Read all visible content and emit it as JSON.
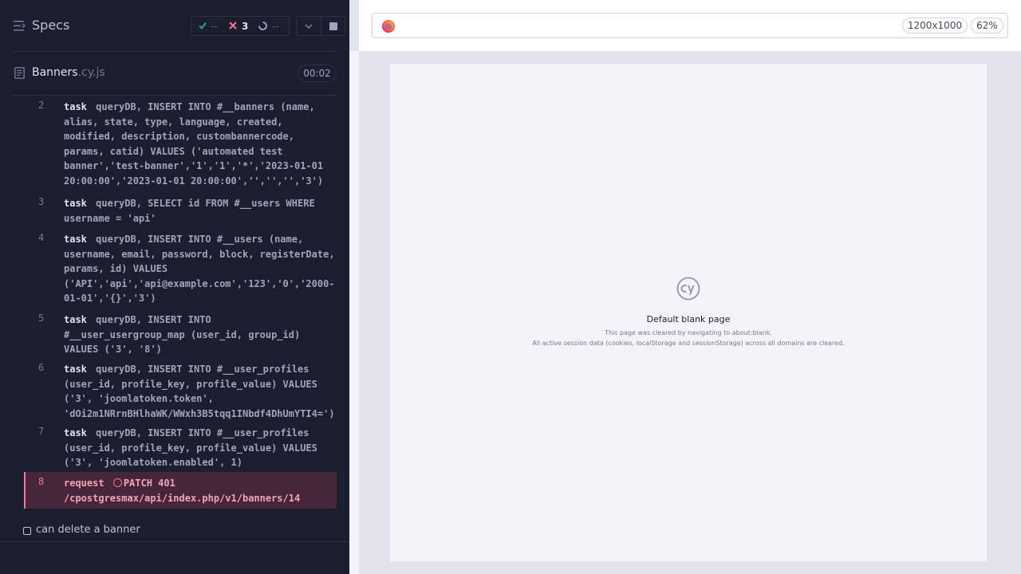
{
  "reporter": {
    "title": "Specs",
    "stats": {
      "passed": "--",
      "failed": "3",
      "pending": "--"
    },
    "file": {
      "name": "Banners",
      "ext": ".cy.js",
      "duration": "00:02"
    },
    "commands": [
      {
        "num": "2",
        "name": "task",
        "message": "queryDB, INSERT INTO #__banners (name, alias, state, type, language, created, modified, description, custombannercode, params, catid) VALUES ('automated test banner','test-banner','1','1','*','2023-01-01 20:00:00','2023-01-01 20:00:00','','','','3')"
      },
      {
        "num": "3",
        "name": "task",
        "message": "queryDB, SELECT id FROM #__users WHERE username = 'api'"
      },
      {
        "num": "4",
        "name": "task",
        "message": "queryDB, INSERT INTO #__users (name, username, email, password, block, registerDate, params, id) VALUES ('API','api','api@example.com','123','0','2000-01-01','{}','3')"
      },
      {
        "num": "5",
        "name": "task",
        "message": "queryDB, INSERT INTO #__user_usergroup_map (user_id, group_id) VALUES ('3', '8')"
      },
      {
        "num": "6",
        "name": "task",
        "message": "queryDB, INSERT INTO #__user_profiles (user_id, profile_key, profile_value) VALUES ('3', 'joomlatoken.token', 'dOi2m1NRrnBHlhaWK/WWxh3B5tqq1INbdf4DhUmYTI4=')"
      },
      {
        "num": "7",
        "name": "task",
        "message": "queryDB, INSERT INTO #__user_profiles (user_id, profile_key, profile_value) VALUES ('3', 'joomlatoken.enabled', 1)"
      },
      {
        "num": "8",
        "name": "request",
        "message": "PATCH 401 /cpostgresmax/api/index.php/v1/banners/14"
      }
    ],
    "test_title": "can delete a banner"
  },
  "aut": {
    "viewport": "1200x1000",
    "zoom": "62%",
    "blank_title": "Default blank page",
    "blank_line1": "This page was cleared by navigating to about:blank.",
    "blank_line2": "All active session data (cookies, localStorage and sessionStorage) across all domains are cleared."
  },
  "colors": {
    "reporter_bg": "#1b1e2e",
    "passed": "#1fa971",
    "failed": "#f07693",
    "aut_bg": "#e1e3ed"
  },
  "icons": [
    "menu-icon",
    "check-icon",
    "x-icon",
    "spinner-icon",
    "chevron-down-icon",
    "stop-icon",
    "file-icon",
    "firefox-icon",
    "cypress-logo-icon"
  ]
}
